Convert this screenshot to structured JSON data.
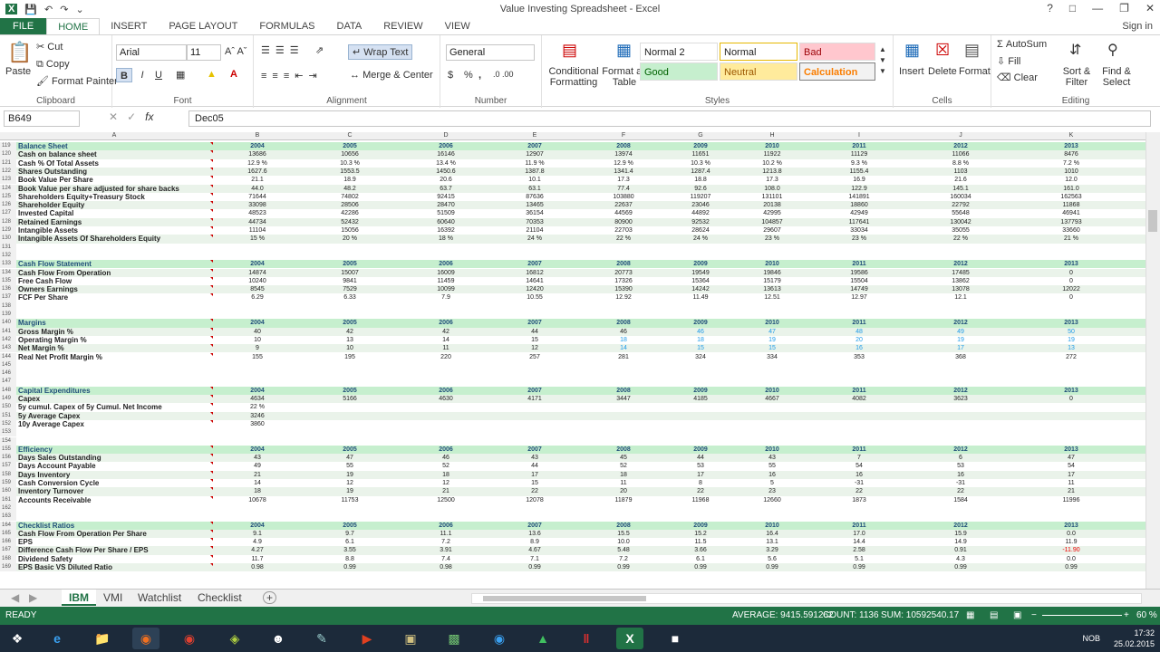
{
  "window": {
    "title": "Value Investing Spreadsheet - Excel",
    "signin": "Sign in"
  },
  "ribbon_tabs": [
    "FILE",
    "HOME",
    "INSERT",
    "PAGE LAYOUT",
    "FORMULAS",
    "DATA",
    "REVIEW",
    "VIEW"
  ],
  "clipboard": {
    "paste": "Paste",
    "cut": "Cut",
    "copy": "Copy",
    "painter": "Format Painter",
    "label": "Clipboard"
  },
  "font": {
    "name": "Arial",
    "size": "11",
    "label": "Font",
    "bold": "B",
    "italic": "I",
    "underline": "U"
  },
  "alignment": {
    "wrap": "Wrap Text",
    "merge": "Merge & Center",
    "label": "Alignment"
  },
  "number": {
    "format": "General",
    "label": "Number",
    "percent": "%",
    "comma": ","
  },
  "styles": {
    "conditional": "Conditional Formatting",
    "format_table": "Format as Table",
    "normal2": "Normal 2",
    "normal": "Normal",
    "bad": "Bad",
    "good": "Good",
    "neutral": "Neutral",
    "calculation": "Calculation",
    "label": "Styles"
  },
  "cells": {
    "insert": "Insert",
    "delete": "Delete",
    "format": "Format",
    "label": "Cells"
  },
  "editing": {
    "autosum": "AutoSum",
    "fill": "Fill",
    "clear": "Clear",
    "sort": "Sort & Filter",
    "find": "Find & Select",
    "label": "Editing"
  },
  "formula_bar": {
    "cell": "B649",
    "value": "Dec05",
    "fx": "fx"
  },
  "columns": [
    "A",
    "B",
    "C",
    "D",
    "E",
    "F",
    "G",
    "H",
    "I",
    "J",
    "K"
  ],
  "sheet_rows": [
    {
      "n": "119",
      "type": "hdr",
      "label": "Balance Sheet",
      "vals": [
        "2004",
        "2005",
        "2006",
        "2007",
        "2008",
        "2009",
        "2010",
        "2011",
        "2012",
        "2013"
      ]
    },
    {
      "n": "120",
      "type": "band",
      "label": "Cash on balance sheet",
      "vals": [
        "13686",
        "10656",
        "16146",
        "12907",
        "13974",
        "11651",
        "11922",
        "11129",
        "11066",
        "8476"
      ]
    },
    {
      "n": "121",
      "type": "",
      "label": "Cash % Of Total Assets",
      "vals": [
        "12.9 %",
        "10.3 %",
        "13.4 %",
        "11.9 %",
        "12.9 %",
        "10.3 %",
        "10.2 %",
        "9.3 %",
        "8.8 %",
        "7.2 %"
      ]
    },
    {
      "n": "122",
      "type": "band",
      "label": "Shares Outstanding",
      "vals": [
        "1627.6",
        "1553.5",
        "1450.6",
        "1387.8",
        "1341.4",
        "1287.4",
        "1213.8",
        "1155.4",
        "1103",
        "1010"
      ]
    },
    {
      "n": "123",
      "type": "",
      "label": "Book Value Per Share",
      "vals": [
        "21.1",
        "18.9",
        "20.6",
        "10.1",
        "17.3",
        "18.8",
        "17.3",
        "16.9",
        "21.6",
        "12.0"
      ]
    },
    {
      "n": "124",
      "type": "band",
      "label": "Book Value per share adjusted for share backs",
      "vals": [
        "44.0",
        "48.2",
        "63.7",
        "63.1",
        "77.4",
        "92.6",
        "108.0",
        "122.9",
        "145.1",
        "161.0"
      ]
    },
    {
      "n": "125",
      "type": "",
      "label": "Shareholders Equity+Treasury Stock",
      "vals": [
        "71644",
        "74802",
        "92415",
        "87636",
        "103880",
        "119207",
        "131101",
        "141891",
        "160034",
        "162563"
      ]
    },
    {
      "n": "126",
      "type": "band",
      "label": "Shareholder Equity",
      "vals": [
        "33098",
        "28506",
        "28470",
        "13465",
        "22637",
        "23046",
        "20138",
        "18860",
        "22792",
        "11868"
      ]
    },
    {
      "n": "127",
      "type": "",
      "label": "Invested Capital",
      "vals": [
        "48523",
        "42286",
        "51509",
        "36154",
        "44569",
        "44892",
        "42995",
        "42949",
        "55648",
        "46941"
      ]
    },
    {
      "n": "128",
      "type": "band",
      "label": "Retained Earnings",
      "vals": [
        "44734",
        "52432",
        "60640",
        "70353",
        "80900",
        "92532",
        "104857",
        "117641",
        "130042",
        "137793"
      ]
    },
    {
      "n": "129",
      "type": "",
      "label": "Intangible Assets",
      "vals": [
        "11104",
        "15056",
        "16392",
        "21104",
        "22703",
        "28624",
        "29607",
        "33034",
        "35055",
        "33660"
      ]
    },
    {
      "n": "130",
      "type": "band",
      "label": "Intangible Assets Of Shareholders Equity",
      "vals": [
        "15 %",
        "20 %",
        "18 %",
        "24 %",
        "22 %",
        "24 %",
        "23 %",
        "23 %",
        "22 %",
        "21 %"
      ]
    },
    {
      "n": "131",
      "type": "",
      "label": "",
      "vals": []
    },
    {
      "n": "132",
      "type": "",
      "label": "",
      "vals": []
    },
    {
      "n": "133",
      "type": "hdr",
      "label": "Cash Flow Statement",
      "vals": [
        "2004",
        "2005",
        "2006",
        "2007",
        "2008",
        "2009",
        "2010",
        "2011",
        "2012",
        "2013"
      ]
    },
    {
      "n": "134",
      "type": "band",
      "label": "Cash Flow From Operation",
      "vals": [
        "14874",
        "15007",
        "16009",
        "16812",
        "20773",
        "19549",
        "19846",
        "19586",
        "17485",
        "0"
      ]
    },
    {
      "n": "135",
      "type": "",
      "label": "Free Cash Flow",
      "vals": [
        "10240",
        "9841",
        "11459",
        "14641",
        "17326",
        "15364",
        "15179",
        "15504",
        "13862",
        "0"
      ]
    },
    {
      "n": "136",
      "type": "band",
      "label": "Owners Earnings",
      "vals": [
        "8545",
        "7529",
        "10099",
        "12420",
        "15390",
        "14242",
        "13613",
        "14749",
        "13078",
        "12022"
      ]
    },
    {
      "n": "137",
      "type": "",
      "label": "FCF Per Share",
      "vals": [
        "6.29",
        "6.33",
        "7.9",
        "10.55",
        "12.92",
        "11.49",
        "12.51",
        "12.97",
        "12.1",
        "0"
      ]
    },
    {
      "n": "138",
      "type": "",
      "label": "",
      "vals": []
    },
    {
      "n": "139",
      "type": "",
      "label": "",
      "vals": []
    },
    {
      "n": "140",
      "type": "hdr",
      "label": "Margins",
      "vals": [
        "2004",
        "2005",
        "2006",
        "2007",
        "2008",
        "2009",
        "2010",
        "2011",
        "2012",
        "2013"
      ]
    },
    {
      "n": "141",
      "type": "band",
      "label": "Gross Margin %",
      "vals": [
        "40",
        "42",
        "42",
        "44",
        "46",
        "46",
        "47",
        "48",
        "49",
        "50"
      ],
      "blue_from": 5
    },
    {
      "n": "142",
      "type": "",
      "label": "Operating Margin %",
      "vals": [
        "10",
        "13",
        "14",
        "15",
        "18",
        "18",
        "19",
        "20",
        "19",
        "19"
      ],
      "blue_from": 4
    },
    {
      "n": "143",
      "type": "band",
      "label": "Net Margin %",
      "vals": [
        "9",
        "10",
        "11",
        "12",
        "14",
        "15",
        "15",
        "16",
        "17",
        "13"
      ],
      "blue_from": 4
    },
    {
      "n": "144",
      "type": "",
      "label": "Real Net Profit Margin %",
      "vals": [
        "155",
        "195",
        "220",
        "257",
        "281",
        "324",
        "334",
        "353",
        "368",
        "272"
      ]
    },
    {
      "n": "145",
      "type": "",
      "label": "",
      "vals": []
    },
    {
      "n": "146",
      "type": "",
      "label": "",
      "vals": []
    },
    {
      "n": "147",
      "type": "",
      "label": "",
      "vals": []
    },
    {
      "n": "148",
      "type": "hdr",
      "label": "Capital Expenditures",
      "vals": [
        "2004",
        "2005",
        "2006",
        "2007",
        "2008",
        "2009",
        "2010",
        "2011",
        "2012",
        "2013"
      ]
    },
    {
      "n": "149",
      "type": "band",
      "label": "Capex",
      "vals": [
        "4634",
        "5166",
        "4630",
        "4171",
        "3447",
        "4185",
        "4667",
        "4082",
        "3623",
        "0"
      ]
    },
    {
      "n": "150",
      "type": "",
      "label": "5y cumul. Capex of 5y Cumul. Net Income",
      "vals": [
        "22 %"
      ]
    },
    {
      "n": "151",
      "type": "band",
      "label": "5y Average Capex",
      "vals": [
        "3246"
      ]
    },
    {
      "n": "152",
      "type": "",
      "label": "10y Average Capex",
      "vals": [
        "3860"
      ]
    },
    {
      "n": "153",
      "type": "",
      "label": "",
      "vals": []
    },
    {
      "n": "154",
      "type": "",
      "label": "",
      "vals": []
    },
    {
      "n": "155",
      "type": "hdr",
      "label": "Efficiency",
      "vals": [
        "2004",
        "2005",
        "2006",
        "2007",
        "2008",
        "2009",
        "2010",
        "2011",
        "2012",
        "2013"
      ]
    },
    {
      "n": "156",
      "type": "band",
      "label": "Days Sales Outstanding",
      "vals": [
        "43",
        "47",
        "46",
        "43",
        "45",
        "44",
        "43",
        "7",
        "6",
        "47"
      ]
    },
    {
      "n": "157",
      "type": "",
      "label": "Days Account Payable",
      "vals": [
        "49",
        "55",
        "52",
        "44",
        "52",
        "53",
        "55",
        "54",
        "53",
        "54"
      ]
    },
    {
      "n": "158",
      "type": "band",
      "label": "Days Inventory",
      "vals": [
        "21",
        "19",
        "18",
        "17",
        "18",
        "17",
        "16",
        "16",
        "16",
        "17"
      ]
    },
    {
      "n": "159",
      "type": "",
      "label": "Cash Conversion Cycle",
      "vals": [
        "14",
        "12",
        "12",
        "15",
        "11",
        "8",
        "5",
        "-31",
        "-31",
        "11"
      ]
    },
    {
      "n": "160",
      "type": "band",
      "label": "Inventory Turnover",
      "vals": [
        "18",
        "19",
        "21",
        "22",
        "20",
        "22",
        "23",
        "22",
        "22",
        "21"
      ]
    },
    {
      "n": "161",
      "type": "",
      "label": "Accounts Receivable",
      "vals": [
        "10678",
        "11753",
        "12500",
        "12078",
        "11879",
        "11968",
        "12660",
        "1873",
        "1584",
        "11996"
      ]
    },
    {
      "n": "162",
      "type": "",
      "label": "",
      "vals": []
    },
    {
      "n": "163",
      "type": "",
      "label": "",
      "vals": []
    },
    {
      "n": "164",
      "type": "hdr",
      "label": "Checklist Ratios",
      "vals": [
        "2004",
        "2005",
        "2006",
        "2007",
        "2008",
        "2009",
        "2010",
        "2011",
        "2012",
        "2013"
      ]
    },
    {
      "n": "165",
      "type": "band",
      "label": "Cash Flow From Operation Per Share",
      "vals": [
        "9.1",
        "9.7",
        "11.1",
        "13.6",
        "15.5",
        "15.2",
        "16.4",
        "17.0",
        "15.9",
        "0.0"
      ]
    },
    {
      "n": "166",
      "type": "",
      "label": "EPS",
      "vals": [
        "4.9",
        "6.1",
        "7.2",
        "8.9",
        "10.0",
        "11.5",
        "13.1",
        "14.4",
        "14.9",
        "11.9"
      ]
    },
    {
      "n": "167",
      "type": "band",
      "label": "Difference Cash Flow Per Share / EPS",
      "vals": [
        "4.27",
        "3.55",
        "3.91",
        "4.67",
        "5.48",
        "3.66",
        "3.29",
        "2.58",
        "0.91",
        "-11.90"
      ],
      "red_last": true
    },
    {
      "n": "168",
      "type": "",
      "label": "Dividend Safety",
      "vals": [
        "11.7",
        "8.8",
        "7.4",
        "7.1",
        "7.2",
        "6.1",
        "5.6",
        "5.1",
        "4.3",
        "0.0"
      ]
    },
    {
      "n": "169",
      "type": "band",
      "label": "EPS Basic VS Diluted Ratio",
      "vals": [
        "0.98",
        "0.99",
        "0.98",
        "0.99",
        "0.99",
        "0.99",
        "0.99",
        "0.99",
        "0.99",
        "0.99"
      ]
    }
  ],
  "sheet_tabs": [
    "IBM",
    "VMI",
    "Watchlist",
    "Checklist"
  ],
  "status": {
    "ready": "READY",
    "average": "AVERAGE: 9415.591262",
    "count": "COUNT: 1136",
    "sum": "SUM: 10592540.17",
    "zoom": "60 %"
  },
  "tray": {
    "lang": "NOB",
    "time": "17:32",
    "date": "25.02.2015"
  }
}
